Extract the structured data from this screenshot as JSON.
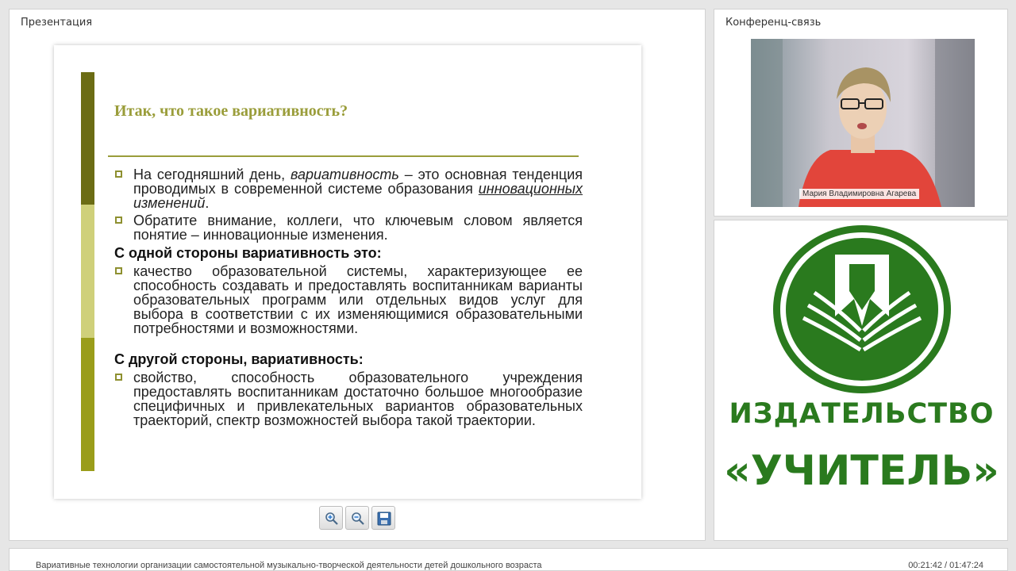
{
  "presentation": {
    "panel_title": "Презентация",
    "slide": {
      "title": "Итак, что такое вариативность?",
      "para1": {
        "a": "На сегодняшний день, ",
        "b": "вариативность",
        "c": " – это основная тенденция проводимых в современной системе образования ",
        "d": "инновационных",
        "e": " ",
        "f": "изменений",
        "g": "."
      },
      "para2": "Обратите внимание, коллеги, что ключевым словом является понятие – инновационные изменения.",
      "heading1": "С одной стороны вариативность это:",
      "para3": "качество образовательной системы, характеризующее ее способность создавать и предоставлять воспитанникам варианты образовательных программ или отдельных видов услуг для выбора в соответствии с их изменяющимися образовательными потребностями и возможностями.",
      "heading2": "С другой стороны, вариативность:",
      "para4": "свойство, способность образовательного учреждения предоставлять воспитанникам достаточно большое многообразие специфичных и привлекательных вариантов образовательных траекторий, спектр возможностей выбора такой траектории.",
      "accent_colors": [
        "#6b6c14",
        "#cfd07a",
        "#9a9d1a"
      ]
    },
    "toolbar": {
      "zoom_in": "zoom-in-icon",
      "zoom_out": "zoom-out-icon",
      "save": "floppy-disk-icon"
    }
  },
  "conference": {
    "panel_title": "Конференц-связь",
    "participant_name": "Мария Владимировна Агарева"
  },
  "logo": {
    "line1": "ИЗДАТЕЛЬСТВО",
    "line2": "«УЧИТЕЛЬ»",
    "color": "#2a7a1e"
  },
  "status": {
    "course_title": "Вариативные технологии организации самостоятельной музыкально-творческой деятельности детей дошкольного возраста",
    "time": "00:21:42 / 01:47:24"
  }
}
